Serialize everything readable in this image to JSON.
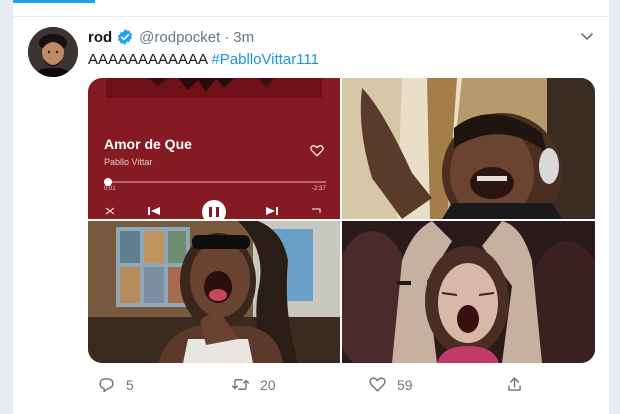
{
  "tweet": {
    "display_name": "rod",
    "handle": "@rodpocket",
    "separator": "·",
    "time": "3m",
    "text": "AAAAAAAAAAAA",
    "hashtag": "#PablloVittar111",
    "verified": true
  },
  "media": {
    "player": {
      "song_title": "Amor de Que",
      "artist": "Pabllo Vittar",
      "elapsed": "0:01",
      "remaining": "-2:37",
      "progress": 0.01
    }
  },
  "actions": {
    "replies": "5",
    "retweets": "20",
    "likes": "59"
  },
  "colors": {
    "accent": "#1da1f2",
    "hashtag": "#1b95e0",
    "muted": "#657786",
    "player_bg": "#861a22"
  }
}
